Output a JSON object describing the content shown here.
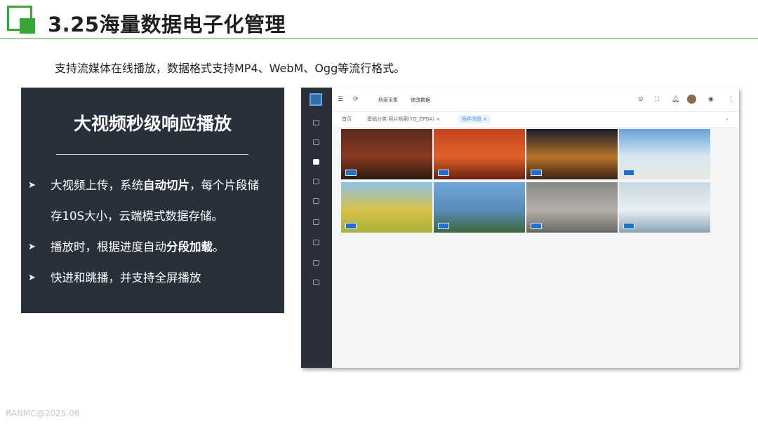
{
  "title": "3.25海量数据电子化管理",
  "intro": "支持流媒体在线播放，数据格式支持MP4、WebM、Ogg等流行格式。",
  "panel": {
    "title": "大视频秒级响应播放",
    "bullets": [
      {
        "pre": "大视频上传，系统",
        "bold": "自动切片",
        "post": "，每个片段储"
      },
      {
        "pre": "存10S大小，云端模式数据存储。",
        "bold": "",
        "post": ""
      },
      {
        "pre": "播放时，根据进度自动",
        "bold": "分段加载",
        "post": "。"
      },
      {
        "pre": "快进和跳播，并支持全屏播放",
        "bold": "",
        "post": ""
      }
    ]
  },
  "app": {
    "breadcrumb": [
      "档案采集",
      "修改数据"
    ],
    "tabs": [
      "首页",
      "基础分类 照片档案(YG_ZPDA)",
      "附件浏览"
    ],
    "sidebar_icons": [
      "home-icon",
      "search-icon",
      "archive-icon",
      "database-icon",
      "document-icon",
      "edit-icon",
      "lock-icon",
      "report-icon",
      "settings-icon"
    ],
    "top_icons": [
      "settings-icon",
      "fullscreen-icon",
      "bell-icon",
      "avatar",
      "globe-icon",
      "more-icon"
    ],
    "thumbnails": [
      {
        "name": "news-anchor",
        "colors": [
          "#5a2a1a",
          "#8b3a20",
          "#2a1a10"
        ]
      },
      {
        "name": "red-stage",
        "colors": [
          "#c8421e",
          "#e0622a",
          "#6a1f10"
        ]
      },
      {
        "name": "night-gate",
        "colors": [
          "#1a1c2a",
          "#b8722a",
          "#3a2414"
        ]
      },
      {
        "name": "rocket-launch",
        "colors": [
          "#6aa0d8",
          "#d8e8f4",
          "#e8e6e0"
        ]
      },
      {
        "name": "harvest-field",
        "colors": [
          "#8cc2e8",
          "#d8c24a",
          "#a8b03a"
        ]
      },
      {
        "name": "city-river",
        "colors": [
          "#6ea8d8",
          "#5a8ab8",
          "#3a6a3a"
        ]
      },
      {
        "name": "moon-surface",
        "colors": [
          "#888888",
          "#b4b0a8",
          "#6a6864"
        ]
      },
      {
        "name": "medical-team",
        "colors": [
          "#c8d8e0",
          "#e8f0f4",
          "#8aa4b4"
        ]
      }
    ]
  },
  "watermark": "RANMC@2025.08"
}
